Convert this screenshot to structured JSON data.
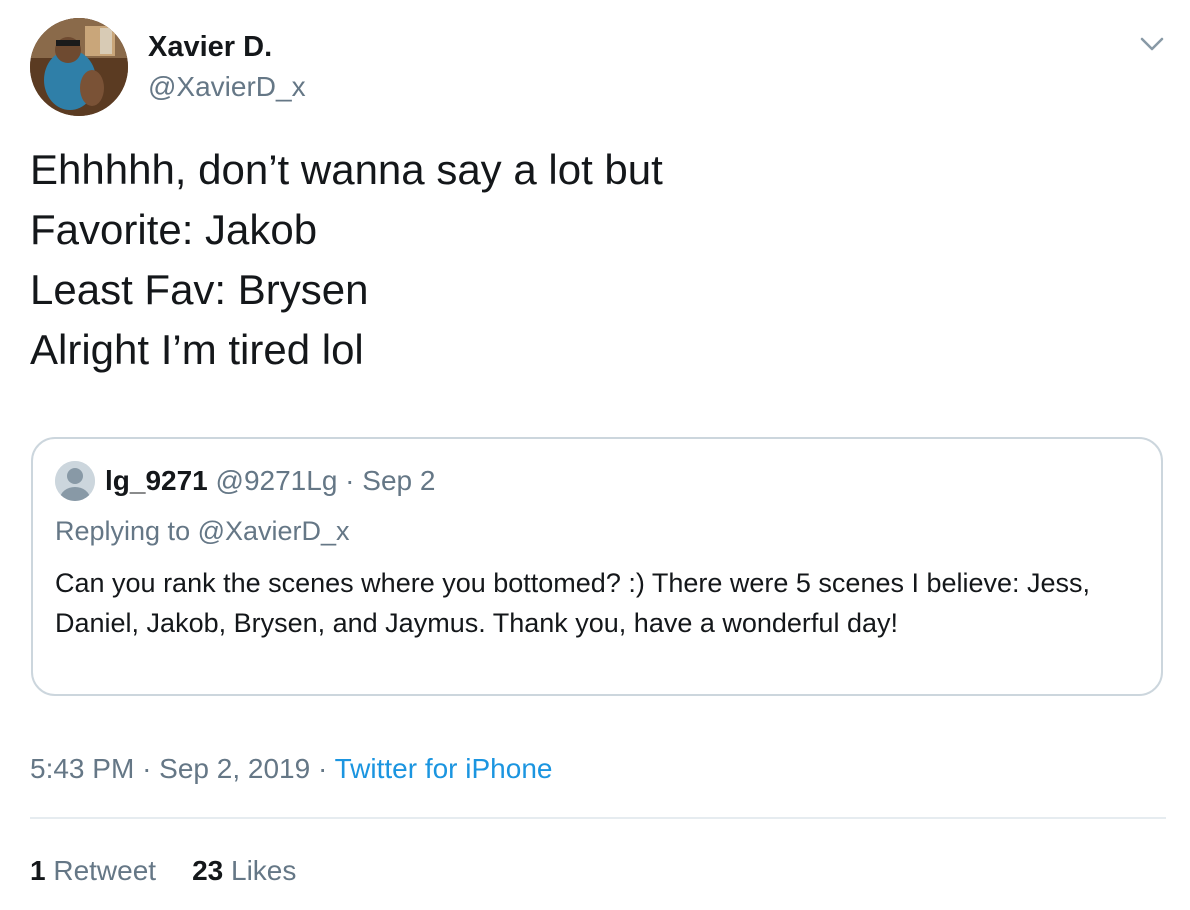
{
  "author": {
    "display_name": "Xavier D.",
    "handle": "@XavierD_x",
    "avatar_icon": "user-photo-avatar"
  },
  "menu_icon": "chevron-down-icon",
  "tweet": {
    "lines": [
      "Ehhhhh, don’t wanna say a lot but",
      "Favorite: Jakob",
      "Least Fav: Brysen",
      "Alright I’m tired lol"
    ]
  },
  "quoted": {
    "avatar_icon": "default-profile-icon",
    "display_name": "lg_9271",
    "handle": "@9271Lg",
    "separator": "·",
    "date": "Sep 2",
    "replying_to": "Replying to @XavierD_x",
    "text": "Can you rank the scenes where you bottomed? :) There were 5 scenes I believe: Jess, Daniel, Jakob, Brysen, and Jaymus. Thank you, have a wonderful day!"
  },
  "meta": {
    "time": "5:43 PM",
    "separator": "·",
    "date": "Sep 2, 2019",
    "source": "Twitter for iPhone"
  },
  "stats": {
    "retweets_count": "1",
    "retweets_label": "Retweet",
    "likes_count": "23",
    "likes_label": "Likes"
  },
  "colors": {
    "text": "#14171a",
    "secondary": "#657786",
    "link": "#1b95e0",
    "border": "#ccd6dd"
  }
}
